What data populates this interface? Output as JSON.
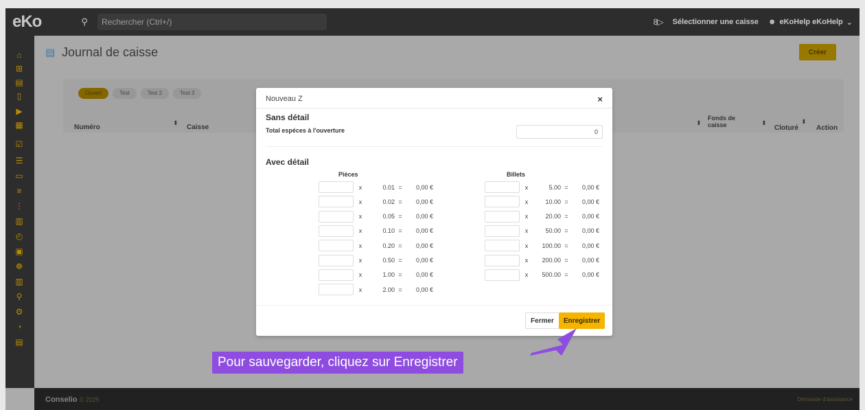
{
  "app": {
    "logo_text": "eKo"
  },
  "topbar": {
    "search_placeholder": "Rechercher (Ctrl+/)",
    "cash_icon_text": "8▷",
    "select_register_label": "Sélectionner une caisse",
    "user_label": "eKoHelp eKoHelp",
    "user_chevron": "⌄"
  },
  "sidebar": {
    "icons": [
      "home-icon",
      "plus-box-icon",
      "list-icon",
      "file-icon",
      "file-arrow-icon",
      "calendar-icon",
      "check-box-icon",
      "list-ordered-icon",
      "folder-icon",
      "tags-icon",
      "tree-icon",
      "register-icon",
      "timer-icon",
      "calculator-icon",
      "bike-icon",
      "bar-chart-icon",
      "search-icon",
      "gears-icon",
      "pie-chart-icon",
      "receipt-icon"
    ],
    "glyphs": [
      "⌂",
      "⊞",
      "▤",
      "▯",
      "▶",
      "▦",
      "☑",
      "☰",
      "▭",
      "≡",
      "⋮",
      "▥",
      "◴",
      "▣",
      "☸",
      "▥",
      "⚲",
      "⚙",
      "◔",
      "▤"
    ]
  },
  "page": {
    "title": "Journal de caisse",
    "title_icon_glyph": "▤",
    "create_label": "Créer",
    "chips": [
      "Ouvert",
      "Test",
      "Test 2",
      "Test 3"
    ],
    "columns": {
      "numero": "Numéro",
      "caisse": "Caisse",
      "fonds_line1": "Fonds de",
      "fonds_line2": "caisse",
      "cloture": "Cloturé",
      "action": "Action"
    },
    "sort_glyph": "⬍"
  },
  "modal": {
    "title": "Nouveau Z",
    "close_glyph": "×",
    "section1": "Sans détail",
    "total_label": "Total espéces à l'ouverture",
    "total_value": "0",
    "section2": "Avec détail",
    "coins_header": "Pièces",
    "bills_header": "Billets",
    "times": "x",
    "equals": "=",
    "coins": [
      {
        "denom": "0.01",
        "amount": "0,00 €"
      },
      {
        "denom": "0.02",
        "amount": "0,00 €"
      },
      {
        "denom": "0.05",
        "amount": "0,00 €"
      },
      {
        "denom": "0.10",
        "amount": "0,00 €"
      },
      {
        "denom": "0.20",
        "amount": "0,00 €"
      },
      {
        "denom": "0.50",
        "amount": "0,00 €"
      },
      {
        "denom": "1.00",
        "amount": "0,00 €"
      },
      {
        "denom": "2.00",
        "amount": "0,00 €"
      }
    ],
    "bills": [
      {
        "denom": "5.00",
        "amount": "0,00 €"
      },
      {
        "denom": "10.00",
        "amount": "0,00 €"
      },
      {
        "denom": "20.00",
        "amount": "0,00 €"
      },
      {
        "denom": "50.00",
        "amount": "0,00 €"
      },
      {
        "denom": "100.00",
        "amount": "0,00 €"
      },
      {
        "denom": "200.00",
        "amount": "0,00 €"
      },
      {
        "denom": "500.00",
        "amount": "0,00 €"
      }
    ],
    "close_label": "Fermer",
    "save_label": "Enregistrer"
  },
  "footer": {
    "brand": "Conselio",
    "year": "© 2025",
    "help": "Demande d'assistance"
  },
  "annotation": {
    "text": "Pour sauvegarder, cliquez sur Enregistrer",
    "color": "#8e4de0"
  },
  "colors": {
    "accent": "#f5b400",
    "topbar": "#3a3a3a",
    "sidebar_icon": "#f0b400"
  }
}
